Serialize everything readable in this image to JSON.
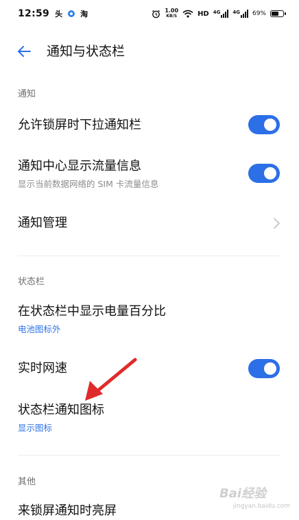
{
  "status_bar": {
    "time": "12:59",
    "app_icon_1": "头",
    "app_icon_3": "淘",
    "speed_value": "1.00",
    "speed_unit": "KB/S",
    "hd": "HD",
    "sim1_label": "4G",
    "sim2_label": "4G",
    "battery": "69%",
    "battery_level": 0.69,
    "icons": [
      "toutiao-app-icon",
      "blue-circle-app-icon",
      "taobao-app-icon",
      "alarm-icon",
      "wifi-icon",
      "signal-icon",
      "signal-icon",
      "battery-icon"
    ]
  },
  "header": {
    "title": "通知与状态栏",
    "back_icon": "back-arrow-icon"
  },
  "sections": {
    "notify": {
      "label": "通知",
      "allow_lockscreen": {
        "title": "允许锁屏时下拉通知栏",
        "toggle": true
      },
      "show_traffic": {
        "title": "通知中心显示流量信息",
        "subtitle": "显示当前数据网络的 SIM 卡流量信息",
        "toggle": true
      },
      "manage": {
        "title": "通知管理",
        "icon": "chevron-right-icon"
      }
    },
    "statusbar": {
      "label": "状态栏",
      "battery_percent": {
        "title": "在状态栏中显示电量百分比",
        "value": "电池图标外"
      },
      "realtime_speed": {
        "title": "实时网速",
        "toggle": true
      },
      "notify_icons": {
        "title": "状态栏通知图标",
        "value": "显示图标"
      }
    },
    "other": {
      "label": "其他",
      "lockscreen_wake": {
        "title": "来锁屏通知时亮屏"
      }
    }
  },
  "annotation": {
    "icon": "red-arrow-annotation"
  },
  "watermark": {
    "text": "Bai经验",
    "url": "jingyan.baidu.com"
  },
  "colors": {
    "accent": "#2c6fe6",
    "arrow": "#e02b2b",
    "section_label": "#6e6e6e"
  }
}
